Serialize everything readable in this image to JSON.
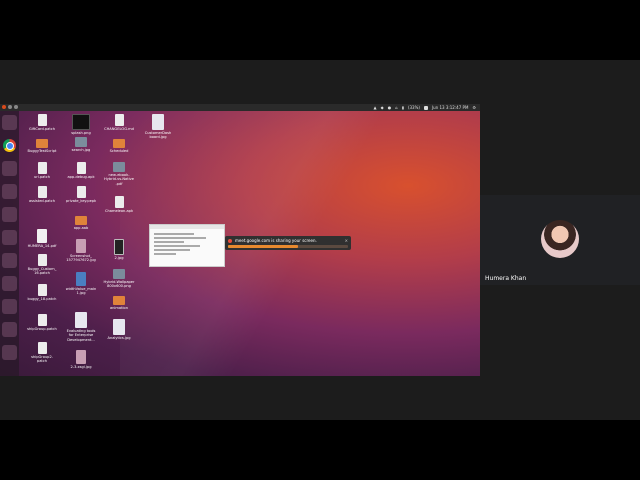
{
  "participant": {
    "name": "Humera Khan"
  },
  "top_panel": {
    "indicators": [
      "▲",
      "◆",
      "●",
      "⌂",
      "▮"
    ],
    "battery": "(33%)",
    "clock": "Jun 13  3:12:47 PM"
  },
  "notification": {
    "text": "meet.google.com is sharing your screen.",
    "close": "×",
    "progress": 0.58
  },
  "desktop_icons": [
    {
      "id": "giftcard",
      "label": "GiftCard.patch",
      "type": "doc"
    },
    {
      "id": "splash",
      "label": "splash.png",
      "type": "black"
    },
    {
      "id": "changelog",
      "label": "CHANGELOG.md",
      "type": "doc"
    },
    {
      "id": "customerdash",
      "label": "CustomerDash\nboard.jpg",
      "type": "tall"
    },
    {
      "id": "buggytest",
      "label": "BuggyTestScript",
      "type": "folder"
    },
    {
      "id": "search",
      "label": "search.jpg",
      "type": "image"
    },
    {
      "id": "scheduled",
      "label": "Scheduled",
      "type": "folder"
    },
    {
      "id": "url",
      "label": "url.patch",
      "type": "doc"
    },
    {
      "id": "appdebug",
      "label": "app-debug.apk",
      "type": "doc"
    },
    {
      "id": "ebook",
      "label": "new-ebook-\nHybrid-vs-Native\n.pdf",
      "type": "image"
    },
    {
      "id": "assisted",
      "label": "assisted.patch",
      "type": "doc"
    },
    {
      "id": "privatekey",
      "label": "private_key.pepk",
      "type": "doc"
    },
    {
      "id": "chameleon",
      "label": "Chameleon.apk",
      "type": "doc"
    },
    {
      "id": "appaab",
      "label": "app.aab",
      "type": "folder"
    },
    {
      "id": "humera",
      "label": "HUMERA_14.pdf",
      "type": "pdf"
    },
    {
      "id": "screenshot",
      "label": "Screenshot_\n1577947672.jpg",
      "type": "jpgpink"
    },
    {
      "id": "phonejpg",
      "label": "2.jpg",
      "type": "phone"
    },
    {
      "id": "buggycustom",
      "label": "Buggy_Custom_\n16.patch",
      "type": "doc"
    },
    {
      "id": "widthvalue",
      "label": "widthValue_main\n1.jpg",
      "type": "blue"
    },
    {
      "id": "hybridwall",
      "label": "Hybrid-Wallpaper\n800x600.png",
      "type": "image"
    },
    {
      "id": "buggy18",
      "label": "buggy_18.patch",
      "type": "doc"
    },
    {
      "id": "animation",
      "label": "animation",
      "type": "folder"
    },
    {
      "id": "shipgroup",
      "label": "shipGroup.patch",
      "type": "doc"
    },
    {
      "id": "evaluating",
      "label": "Evaluating tools\nfor Enterprise\nDevelopment...",
      "type": "tall"
    },
    {
      "id": "analytics",
      "label": "Analytics.jpg",
      "type": "tall"
    },
    {
      "id": "shipgroup2",
      "label": "shipGroup2.\npatch",
      "type": "doc"
    },
    {
      "id": "twothree",
      "label": "2-3.xsgi.jpg",
      "type": "jpgpink"
    }
  ]
}
